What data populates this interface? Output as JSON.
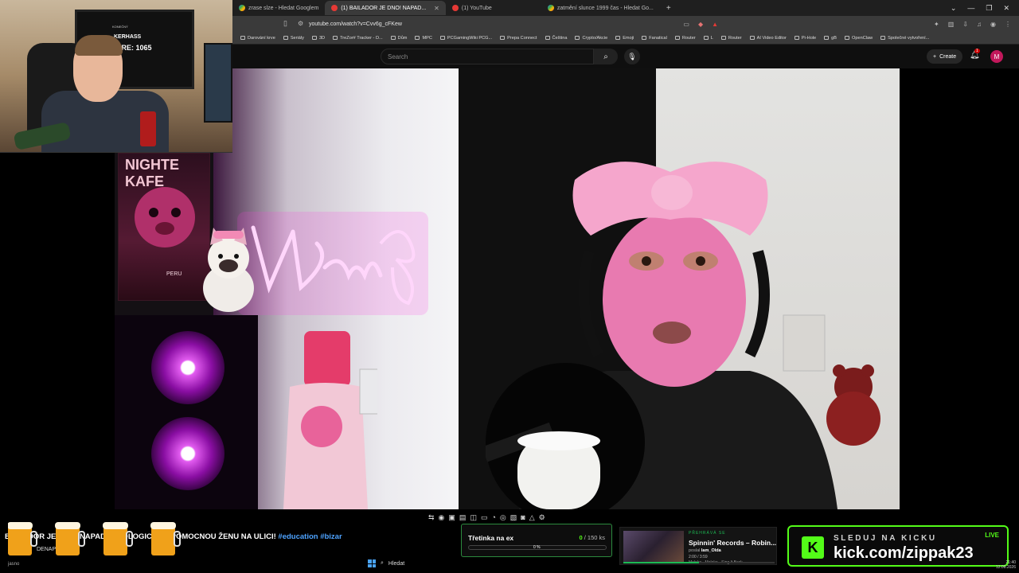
{
  "browser": {
    "tabs": [
      {
        "label": "zrase slze - Hledat Googlem",
        "active": false
      },
      {
        "label": "(1) BAILADOR JE DNO! NAPAD...",
        "active": true
      },
      {
        "label": "(1) YouTube",
        "active": false
      },
      {
        "label": "zatmění slunce 1999 čas - Hledat Go...",
        "active": false
      }
    ],
    "url": "youtube.com/watch?v=Cvv6g_cFKew",
    "bookmarks": [
      "Darování krve",
      "Seriály",
      "3D",
      "TreZor# Tracker - D...",
      "Dům",
      "MPC",
      "PCGamingWiki PCG...",
      "Prepa Connect",
      "Čeština",
      "Crypto/Akcie",
      "Emoji",
      "Fanatical",
      "Router",
      "L",
      "Router",
      "AI Video Editor",
      "Pi-Hole",
      "gB",
      "OpenClaw",
      "Společné vytvoření..."
    ]
  },
  "youtube": {
    "search_placeholder": "Search",
    "create_label": "Create",
    "notif_count": "1",
    "avatar_letter": "M"
  },
  "facecam": {
    "tv_line0": "KONEČNÝ",
    "tv_line1": "KERHASS",
    "tv_line2": "SKÓRE: 1065"
  },
  "video": {
    "kafe_title": "NIGHTE KAFE",
    "kafe_origin": "PERU"
  },
  "overlay": {
    "ticker_text": "BAILADOR JE DNO! NAPADL TEOLOGICKOU POMOCNOU ŽENU NA ULICI!",
    "ticker_tags": "#education #bizar",
    "small_left": "jasno",
    "small_left2": "DENAP",
    "sub_goal": {
      "label": "Třetinka na ex",
      "current": "0",
      "target": "/ 150 ks",
      "percent": 0,
      "percent_label": "0 %"
    },
    "spotify": {
      "header": "PŘEHRÁVÁ SE",
      "song": "Spinnin' Records – Robin...",
      "requester_prefix": "poslal",
      "requester": "Iam_Olda",
      "time": "2:00 / 3:59",
      "sub": "Moloko - Moloko - Sing It Back",
      "progress": 0.5
    },
    "kick": {
      "top": "SLEDUJ NA KICKU",
      "live": "LIVE",
      "url": "kick.com/zippak23",
      "logo": "K"
    },
    "taskbar_search": "Hledat",
    "clock_time": "21:40",
    "clock_date": "12.08.2026"
  },
  "colors": {
    "kick_green": "#53fc18",
    "yt_red": "#cc0000",
    "spotify_green": "#1db954",
    "tag_blue": "#4ea3ff"
  }
}
